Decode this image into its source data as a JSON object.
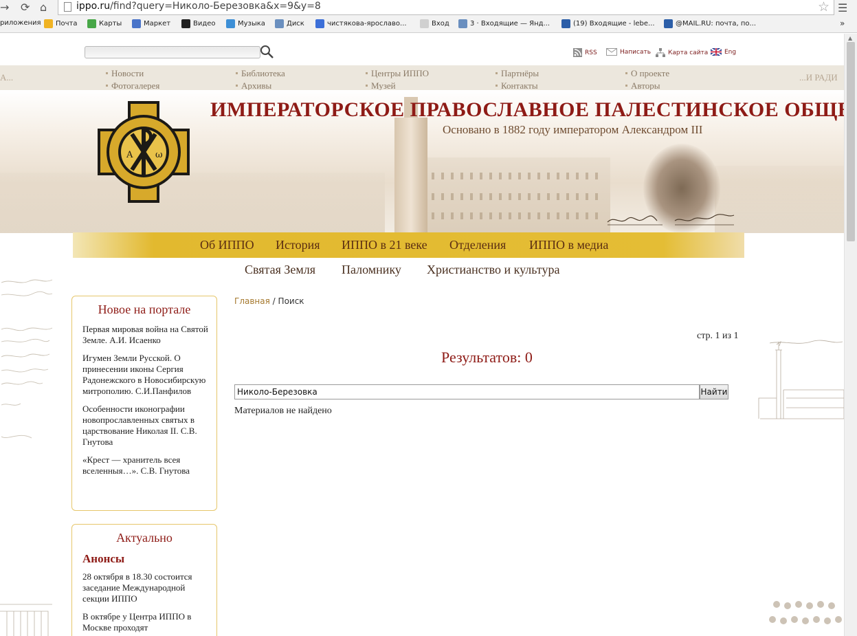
{
  "browser": {
    "url_host": "ippo.ru",
    "url_path": "/find?query=Николо-Березовка&x=9&y=8"
  },
  "bookmarks": [
    {
      "label": "риложения",
      "icon": "apps-icon",
      "color": "#4a8fd8"
    },
    {
      "label": "Почта",
      "icon": "mail-icon",
      "color": "#f0b323"
    },
    {
      "label": "Карты",
      "icon": "maps-icon",
      "color": "#48a748"
    },
    {
      "label": "Маркет",
      "icon": "market-icon",
      "color": "#4a74c9"
    },
    {
      "label": "Видео",
      "icon": "video-icon",
      "color": "#222222"
    },
    {
      "label": "Музыка",
      "icon": "music-icon",
      "color": "#3d8fd6"
    },
    {
      "label": "Диск",
      "icon": "disk-icon",
      "color": "#6a8fbf"
    },
    {
      "label": "чистякова-ярославо...",
      "icon": "google-icon",
      "color": "#3c6fd8"
    },
    {
      "label": "Вход",
      "icon": "page-icon",
      "color": "#d0d0d0"
    },
    {
      "label": "3 · Входящие — Янд...",
      "icon": "mail-icon",
      "color": "#6a8fbf"
    },
    {
      "label": "(19) Входящие - lebe...",
      "icon": "at-icon",
      "color": "#2c5ea8"
    },
    {
      "label": "@MAIL.RU: почта, по...",
      "icon": "at-icon",
      "color": "#2c5ea8"
    }
  ],
  "utility": {
    "rss": "RSS",
    "write": "Написать",
    "sitemap": "Карта сайта",
    "eng": "Eng"
  },
  "topnav": {
    "left_edge": "А...",
    "right_edge": "...И РАДИ",
    "columns": [
      {
        "top": "Новости",
        "bottom": "Фотогалерея"
      },
      {
        "top": "Библиотека",
        "bottom": "Архивы"
      },
      {
        "top": "Центры ИППО",
        "bottom": "Музей"
      },
      {
        "top": "Партнёры",
        "bottom": "Контакты"
      },
      {
        "top": "О проекте",
        "bottom": "Авторы"
      }
    ]
  },
  "banner": {
    "title": "ИМПЕРАТОРСКОЕ ПРАВОСЛАВНОЕ ПАЛЕСТИНСКОЕ ОБЩЕСТВО",
    "subtitle": "Основано в 1882 году императором Александром III"
  },
  "main_nav": [
    "Об ИППО",
    "История",
    "ИППО в 21 веке",
    "Отделения",
    "ИППО в медиа"
  ],
  "secondary_nav": [
    "Святая Земля",
    "Паломнику",
    "Христианство и культура"
  ],
  "sidebar": {
    "new_title": "Новое на портале",
    "new_items": [
      "Первая мировая война на Святой Земле. А.И. Исаенко",
      "Игумен Земли Русской. О принесении иконы Сергия Радонежского в Новосибирскую митрополию. С.И.Панфилов",
      "Особенности иконографии новопрославленных святых в царствование Николая II. С.В. Гнутова",
      "«Крест — хранитель всея вселенныя…». С.В. Гнутова"
    ],
    "actual_title": "Актуально",
    "announce_heading": "Анонсы",
    "announce_items": [
      "28 октября в 18.30 состоится заседание Международной секции ИППО",
      "В октябре у Центра ИППО в Москве проходят"
    ]
  },
  "content": {
    "breadcrumb_home": "Главная",
    "breadcrumb_sep": "/",
    "breadcrumb_current": "Поиск",
    "pager": "стр. 1 из 1",
    "results": "Результатов: 0",
    "query_value": "Николо-Березовка",
    "find_button": "Найти",
    "no_results": "Материалов не найдено"
  }
}
